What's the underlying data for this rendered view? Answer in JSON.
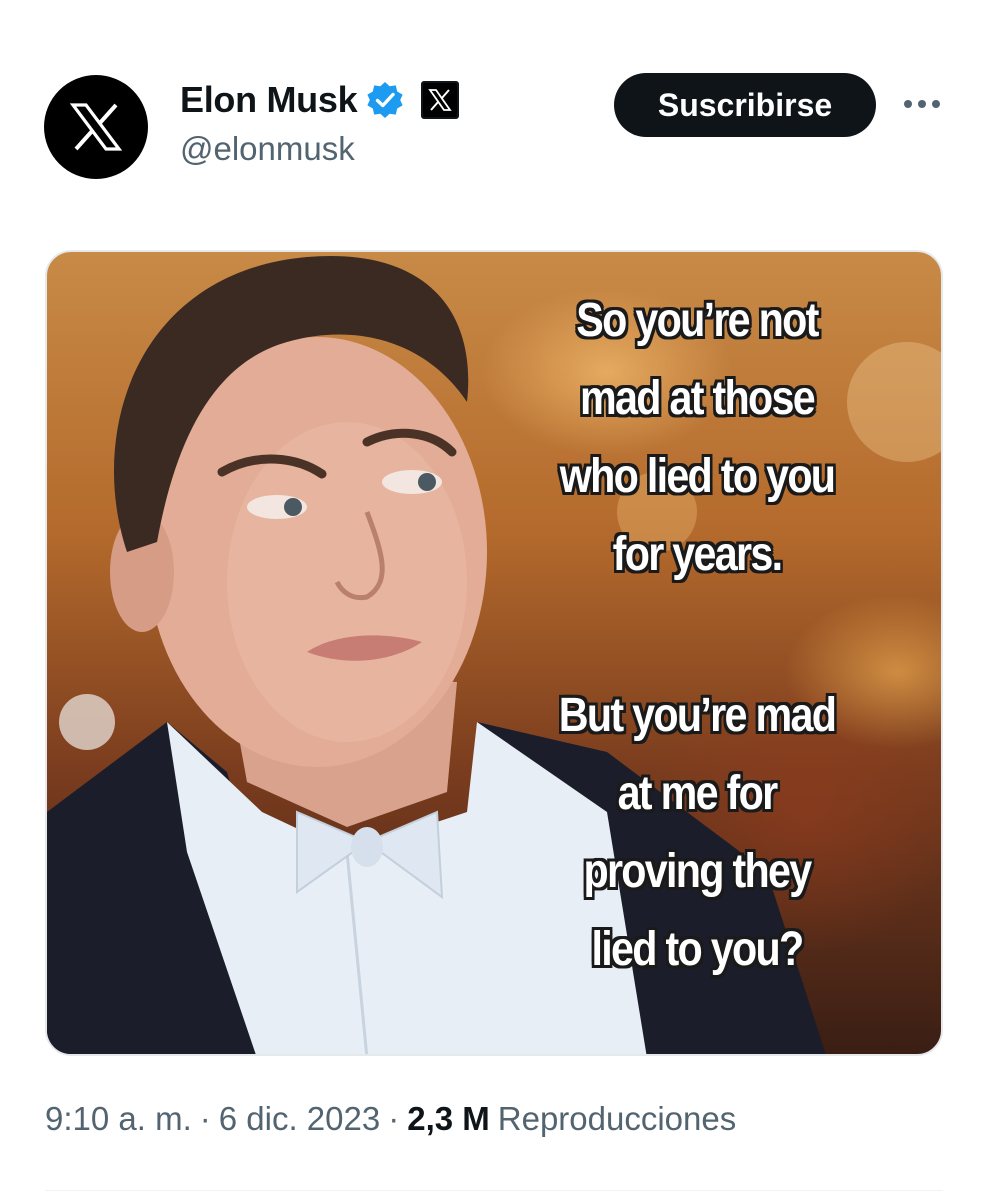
{
  "author": {
    "display_name": "Elon Musk",
    "handle": "@elonmusk"
  },
  "header": {
    "subscribe_label": "Suscribirse",
    "more_icon": "more-horizontal-icon"
  },
  "media": {
    "caption_top": "So you’re not\nmad at those\nwho lied to you\nfor years.",
    "caption_bottom": "But you’re mad\nat me for\nproving they\nlied to you?"
  },
  "meta": {
    "time": "9:10 a. m.",
    "separator": "·",
    "date": "6 dic. 2023",
    "views_count": "2,3 M",
    "views_label": "Reproducciones"
  },
  "colors": {
    "verified": "#1d9bf0",
    "button_bg": "#0f1419",
    "secondary_text": "#536471"
  }
}
